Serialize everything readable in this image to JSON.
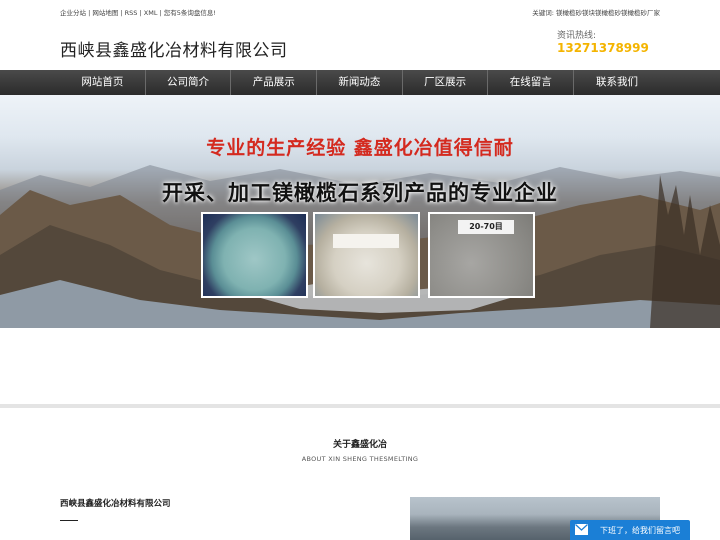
{
  "topbar": {
    "links": [
      "企业分站",
      "网站地图",
      "RSS",
      "XML"
    ],
    "notice": "您有5条询盘信息!",
    "keywords_label": "关键词:",
    "keywords": "镁橄榄砂镁块镁橄榄砂镁橄榄砂厂家"
  },
  "header": {
    "brand": "西峡县鑫盛化冶材料有限公司",
    "hotline_label": "资讯热线:",
    "hotline_phone": "13271378999",
    "phone_color": "#f4b400"
  },
  "nav": {
    "items": [
      "网站首页",
      "公司简介",
      "产品展示",
      "新闻动态",
      "厂区展示",
      "在线留言",
      "联系我们"
    ]
  },
  "banner": {
    "slogan_top": "专业的生产经验   鑫盛化冶值得信耐",
    "slogan_main": "开采、加工镁橄榄石系列产品的专业企业",
    "product3_tag": "20-70目",
    "slogan_color": "#d42a1f"
  },
  "about": {
    "title": "关于鑫盛化冶",
    "subtitle": "ABOUT XIN SHENG THESMELTING",
    "company_name": "西峡县鑫盛化冶材料有限公司"
  },
  "message_bar": {
    "label": "下班了，给我们留言吧",
    "icon": "mail-icon",
    "color": "#1b7fd6"
  }
}
